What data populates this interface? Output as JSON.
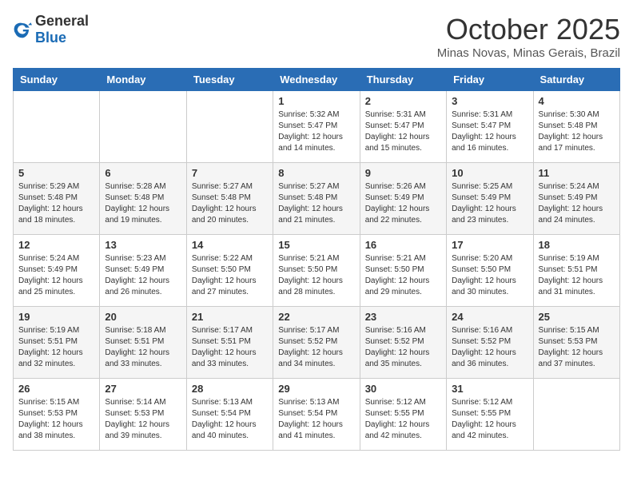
{
  "logo": {
    "text_general": "General",
    "text_blue": "Blue"
  },
  "header": {
    "month": "October 2025",
    "location": "Minas Novas, Minas Gerais, Brazil"
  },
  "weekdays": [
    "Sunday",
    "Monday",
    "Tuesday",
    "Wednesday",
    "Thursday",
    "Friday",
    "Saturday"
  ],
  "weeks": [
    [
      {
        "day": "",
        "info": ""
      },
      {
        "day": "",
        "info": ""
      },
      {
        "day": "",
        "info": ""
      },
      {
        "day": "1",
        "info": "Sunrise: 5:32 AM\nSunset: 5:47 PM\nDaylight: 12 hours\nand 14 minutes."
      },
      {
        "day": "2",
        "info": "Sunrise: 5:31 AM\nSunset: 5:47 PM\nDaylight: 12 hours\nand 15 minutes."
      },
      {
        "day": "3",
        "info": "Sunrise: 5:31 AM\nSunset: 5:47 PM\nDaylight: 12 hours\nand 16 minutes."
      },
      {
        "day": "4",
        "info": "Sunrise: 5:30 AM\nSunset: 5:48 PM\nDaylight: 12 hours\nand 17 minutes."
      }
    ],
    [
      {
        "day": "5",
        "info": "Sunrise: 5:29 AM\nSunset: 5:48 PM\nDaylight: 12 hours\nand 18 minutes."
      },
      {
        "day": "6",
        "info": "Sunrise: 5:28 AM\nSunset: 5:48 PM\nDaylight: 12 hours\nand 19 minutes."
      },
      {
        "day": "7",
        "info": "Sunrise: 5:27 AM\nSunset: 5:48 PM\nDaylight: 12 hours\nand 20 minutes."
      },
      {
        "day": "8",
        "info": "Sunrise: 5:27 AM\nSunset: 5:48 PM\nDaylight: 12 hours\nand 21 minutes."
      },
      {
        "day": "9",
        "info": "Sunrise: 5:26 AM\nSunset: 5:49 PM\nDaylight: 12 hours\nand 22 minutes."
      },
      {
        "day": "10",
        "info": "Sunrise: 5:25 AM\nSunset: 5:49 PM\nDaylight: 12 hours\nand 23 minutes."
      },
      {
        "day": "11",
        "info": "Sunrise: 5:24 AM\nSunset: 5:49 PM\nDaylight: 12 hours\nand 24 minutes."
      }
    ],
    [
      {
        "day": "12",
        "info": "Sunrise: 5:24 AM\nSunset: 5:49 PM\nDaylight: 12 hours\nand 25 minutes."
      },
      {
        "day": "13",
        "info": "Sunrise: 5:23 AM\nSunset: 5:49 PM\nDaylight: 12 hours\nand 26 minutes."
      },
      {
        "day": "14",
        "info": "Sunrise: 5:22 AM\nSunset: 5:50 PM\nDaylight: 12 hours\nand 27 minutes."
      },
      {
        "day": "15",
        "info": "Sunrise: 5:21 AM\nSunset: 5:50 PM\nDaylight: 12 hours\nand 28 minutes."
      },
      {
        "day": "16",
        "info": "Sunrise: 5:21 AM\nSunset: 5:50 PM\nDaylight: 12 hours\nand 29 minutes."
      },
      {
        "day": "17",
        "info": "Sunrise: 5:20 AM\nSunset: 5:50 PM\nDaylight: 12 hours\nand 30 minutes."
      },
      {
        "day": "18",
        "info": "Sunrise: 5:19 AM\nSunset: 5:51 PM\nDaylight: 12 hours\nand 31 minutes."
      }
    ],
    [
      {
        "day": "19",
        "info": "Sunrise: 5:19 AM\nSunset: 5:51 PM\nDaylight: 12 hours\nand 32 minutes."
      },
      {
        "day": "20",
        "info": "Sunrise: 5:18 AM\nSunset: 5:51 PM\nDaylight: 12 hours\nand 33 minutes."
      },
      {
        "day": "21",
        "info": "Sunrise: 5:17 AM\nSunset: 5:51 PM\nDaylight: 12 hours\nand 33 minutes."
      },
      {
        "day": "22",
        "info": "Sunrise: 5:17 AM\nSunset: 5:52 PM\nDaylight: 12 hours\nand 34 minutes."
      },
      {
        "day": "23",
        "info": "Sunrise: 5:16 AM\nSunset: 5:52 PM\nDaylight: 12 hours\nand 35 minutes."
      },
      {
        "day": "24",
        "info": "Sunrise: 5:16 AM\nSunset: 5:52 PM\nDaylight: 12 hours\nand 36 minutes."
      },
      {
        "day": "25",
        "info": "Sunrise: 5:15 AM\nSunset: 5:53 PM\nDaylight: 12 hours\nand 37 minutes."
      }
    ],
    [
      {
        "day": "26",
        "info": "Sunrise: 5:15 AM\nSunset: 5:53 PM\nDaylight: 12 hours\nand 38 minutes."
      },
      {
        "day": "27",
        "info": "Sunrise: 5:14 AM\nSunset: 5:53 PM\nDaylight: 12 hours\nand 39 minutes."
      },
      {
        "day": "28",
        "info": "Sunrise: 5:13 AM\nSunset: 5:54 PM\nDaylight: 12 hours\nand 40 minutes."
      },
      {
        "day": "29",
        "info": "Sunrise: 5:13 AM\nSunset: 5:54 PM\nDaylight: 12 hours\nand 41 minutes."
      },
      {
        "day": "30",
        "info": "Sunrise: 5:12 AM\nSunset: 5:55 PM\nDaylight: 12 hours\nand 42 minutes."
      },
      {
        "day": "31",
        "info": "Sunrise: 5:12 AM\nSunset: 5:55 PM\nDaylight: 12 hours\nand 42 minutes."
      },
      {
        "day": "",
        "info": ""
      }
    ]
  ]
}
